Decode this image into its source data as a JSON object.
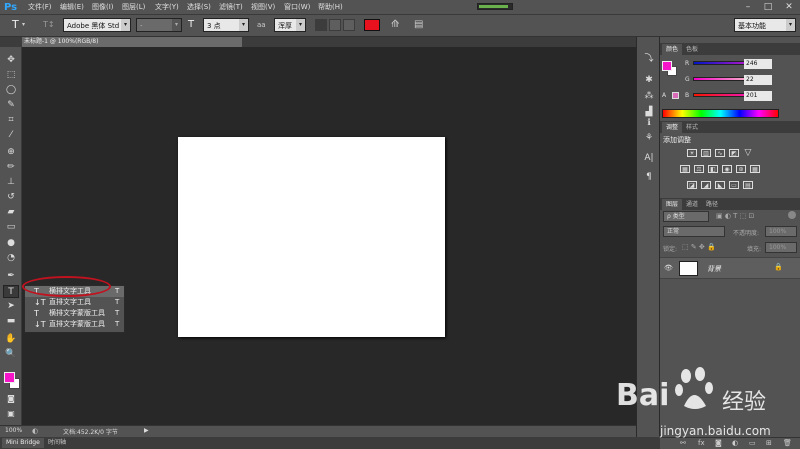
{
  "app": {
    "logo": "Ps"
  },
  "menu": [
    "文件(F)",
    "编辑(E)",
    "图像(I)",
    "图层(L)",
    "文字(Y)",
    "选择(S)",
    "滤镜(T)",
    "视图(V)",
    "窗口(W)",
    "帮助(H)"
  ],
  "progress": {
    "value": 0.85,
    "color": "#6ab04c"
  },
  "options": {
    "tool_icon": "T",
    "orient_icon": "T↕",
    "font_family": "Adobe 黑体 Std",
    "font_style": "-",
    "size_icon": "T",
    "font_size": "3 点",
    "aa_icon": "aa",
    "antialias": "浑厚",
    "text_color": "#e8111d",
    "workspace": "基本功能"
  },
  "document": {
    "tab_title": "未标题-1 @ 100%(RGB/8)"
  },
  "status": {
    "zoom": "100%",
    "doc_info": "文档:452.2K/0 字节"
  },
  "bottom_tabs": [
    "Mini Bridge",
    "时间轴"
  ],
  "flyout": [
    {
      "icon": "T",
      "label": "横排文字工具",
      "key": "T",
      "selected": true
    },
    {
      "icon": "↓T",
      "label": "直排文字工具",
      "key": "T",
      "selected": false
    },
    {
      "icon": "T",
      "label": "横排文字蒙版工具",
      "key": "T",
      "selected": false
    },
    {
      "icon": "↓T",
      "label": "直排文字蒙版工具",
      "key": "T",
      "selected": false
    }
  ],
  "colors": {
    "foreground": "#f616c9",
    "background": "#ffffff",
    "accent_ring": "#c1121f"
  },
  "color_panel": {
    "tabs": [
      "颜色",
      "色板"
    ],
    "r_label": "R",
    "g_label": "G",
    "b_label": "B",
    "r_value": "246",
    "g_value": "22",
    "b_value": "201"
  },
  "adjust_panel": {
    "tabs": [
      "调整",
      "样式"
    ],
    "heading": "添加调整"
  },
  "layers_panel": {
    "tabs": [
      "图层",
      "通道",
      "路径"
    ],
    "filter": "ρ 类型",
    "blend_mode": "正常",
    "opacity_label": "不透明度:",
    "opacity_value": "100%",
    "lock_label": "锁定:",
    "fill_label": "填充:",
    "fill_value": "100%",
    "layer_name": "背景"
  },
  "watermark": {
    "brand": "Bai",
    "brand2": "经验",
    "url": "jingyan.baidu.com"
  }
}
